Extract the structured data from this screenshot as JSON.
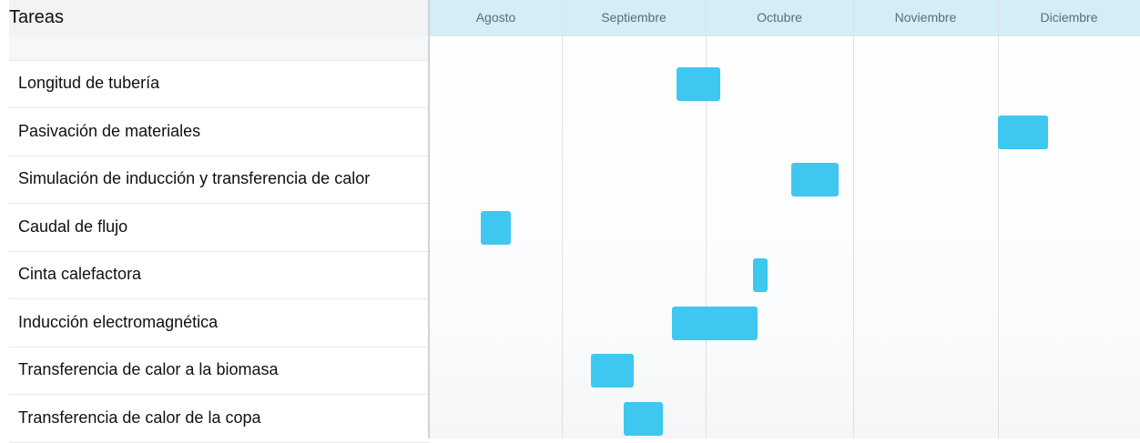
{
  "chart_data": {
    "type": "gantt",
    "task_column_header": "Tareas",
    "months": [
      "Agosto",
      "Septiembre",
      "Octubre",
      "Noviembre",
      "Diciembre"
    ],
    "tasks": [
      {
        "name": "Longitud de tubería",
        "start": "Septiembre 25",
        "end": "Octubre 4"
      },
      {
        "name": "Pasivación de materiales",
        "start": "Diciembre 1",
        "end": "Diciembre 12"
      },
      {
        "name": "Simulación de inducción y transferencia de calor",
        "start": "Octubre 19",
        "end": "Octubre 29"
      },
      {
        "name": "Caudal de flujo",
        "start": "Agosto 13",
        "end": "Agosto 20"
      },
      {
        "name": "Cinta calefactora",
        "start": "Octubre 11",
        "end": "Octubre 14"
      },
      {
        "name": "Inducción electromagnética",
        "start": "Septiembre 24",
        "end": "Octubre 12"
      },
      {
        "name": "Transferencia de calor a la biomasa",
        "start": "Septiembre 7",
        "end": "Septiembre 16"
      },
      {
        "name": "Transferencia de calor de la copa",
        "start": "Septiembre 14",
        "end": "Septiembre 22"
      }
    ],
    "bar_color": "#3ec7ef",
    "header_color": "#d4edf7"
  }
}
